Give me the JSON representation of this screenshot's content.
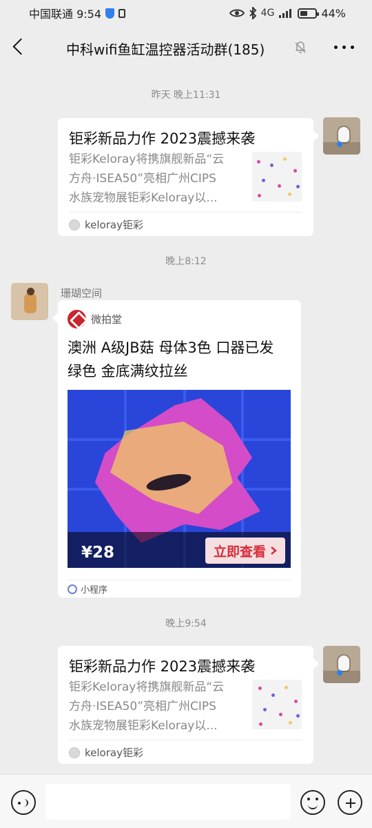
{
  "status_bar": {
    "carrier_time": "中国联通 9:54",
    "battery": "44%",
    "icons": [
      "shield-icon",
      "lock-icon",
      "eye-icon",
      "bluetooth-icon",
      "signal-icon",
      "battery-icon"
    ],
    "network_text": "4G"
  },
  "header": {
    "title": "中科wifi鱼缸温控器活动群(185)",
    "back_icon": "chevron-left-icon",
    "mute_icon": "bell-off-icon",
    "more_icon": "more-horizontal-icon"
  },
  "messages": [
    {
      "time": "昨天 晚上11:31",
      "type": "article",
      "title": "钜彩新品力作 2023震撼来袭",
      "description_lines": [
        "钜彩Keloray将携旗舰新品“云",
        "方舟·ISEA50”亮相广州CIPS",
        "水族宠物展钜彩Keloray以..."
      ],
      "source": "keloray钜彩"
    },
    {
      "time": "晚上8:12",
      "sender": "珊瑚空间",
      "type": "mini_program",
      "app_name": "微拍堂",
      "title": "澳洲 A级JB菇 母体3色 口器已发绿色 金底满纹拉丝",
      "price": "¥28",
      "button": "立即查看",
      "footer": "小程序"
    },
    {
      "time": "晚上9:54",
      "type": "article",
      "title": "钜彩新品力作 2023震撼来袭",
      "description_lines": [
        "钜彩Keloray将携旗舰新品“云",
        "方舟·ISEA50”亮相广州CIPS",
        "水族宠物展钜彩Keloray以..."
      ],
      "source": "keloray钜彩"
    }
  ],
  "input_bar": {
    "placeholder": ""
  }
}
